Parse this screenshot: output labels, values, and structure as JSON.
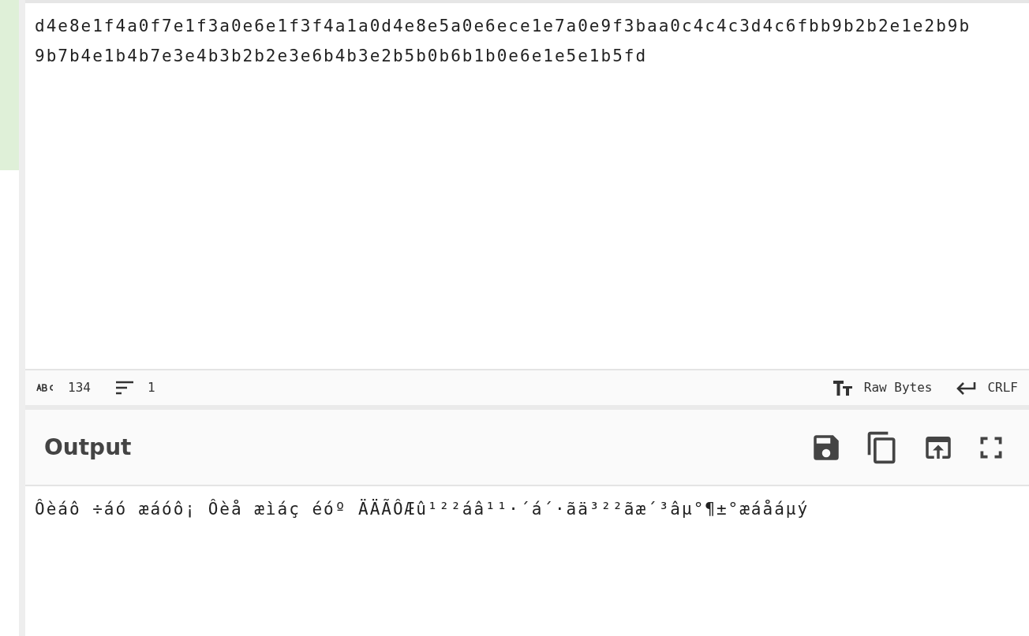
{
  "input": {
    "lines": [
      "d4e8e1f4a0f7e1f3a0e6e1f3f4a1a0d4e8e5a0e6ece1e7a0e9f3baa0c4c4c3d4c6fbb9b2b2e1e2b9b",
      "9b7b4e1b4b7e3e4b3b2b2e3e6b4b3e2b5b0b6b1b0e6e1e5e1b5fd"
    ]
  },
  "status_bar": {
    "length": "134",
    "lines": "1",
    "encoding": "Raw Bytes",
    "eol": "CRLF"
  },
  "output": {
    "title": "Output",
    "text": "Ôèáô ÷áó æáóô¡ Ôèå æìáç éóº ÄÄÃÔÆû¹²²áâ¹¹·´á´·ãä³²²ãæ´³âµ°¶±°æáåáµý"
  }
}
